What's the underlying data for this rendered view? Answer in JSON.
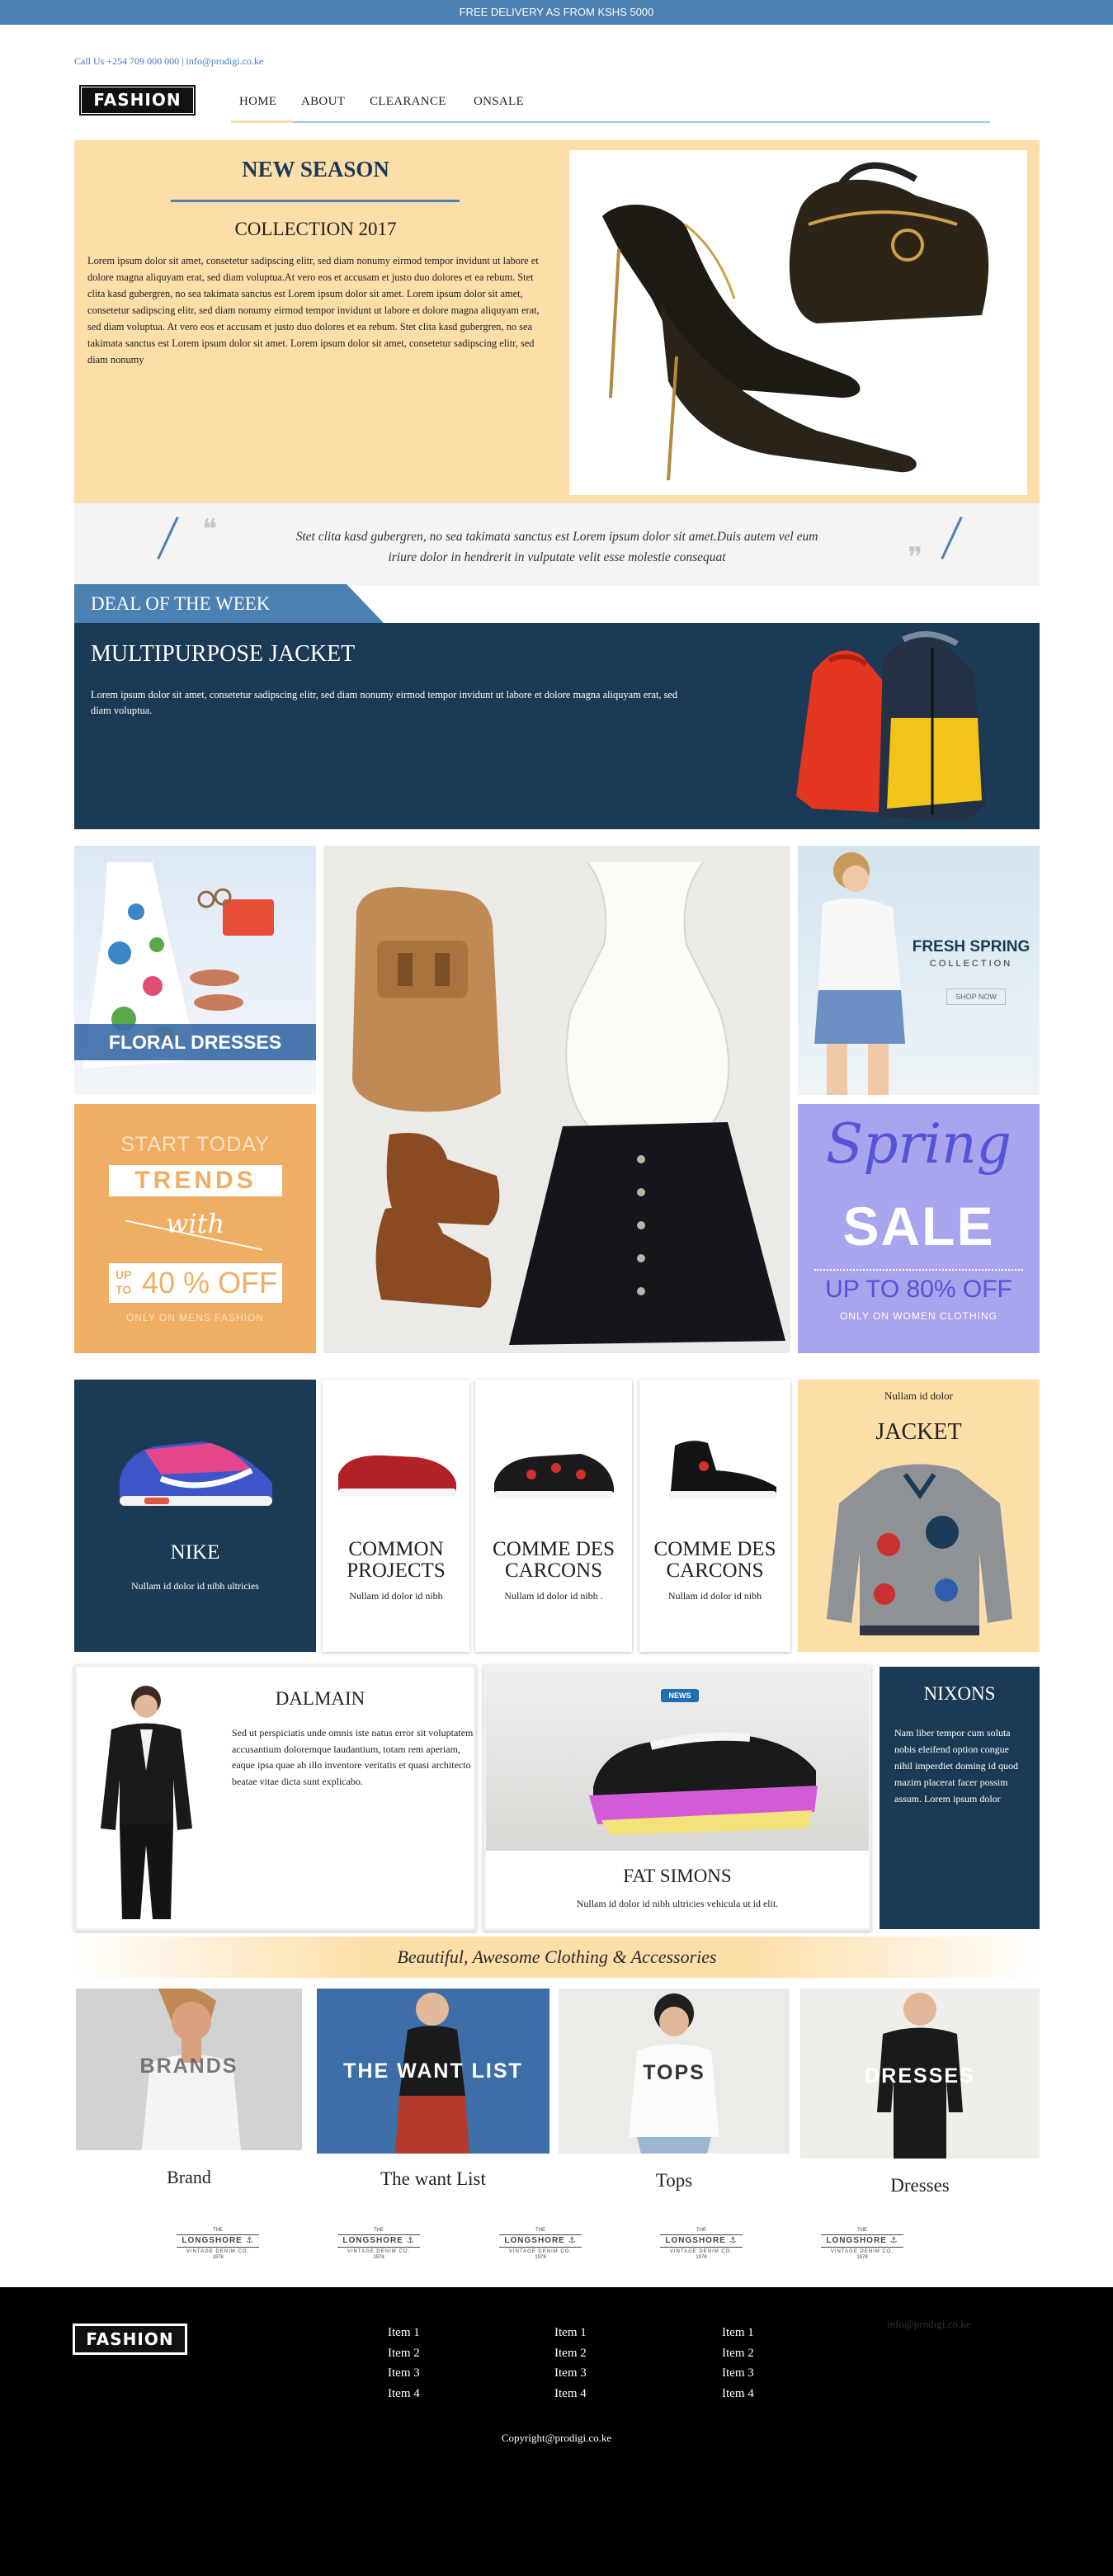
{
  "topbar": {
    "text": "FREE DELIVERY AS FROM KSHS 5000"
  },
  "header": {
    "contact": "Call Us +254 709 000 000 | info@prodigi.co.ke",
    "logo": "FASHION",
    "nav": [
      {
        "label": "HOME"
      },
      {
        "label": "ABOUT"
      },
      {
        "label": "CLEARANCE"
      },
      {
        "label": "ONSALE"
      }
    ]
  },
  "hero": {
    "title": "NEW SEASON",
    "subtitle": "COLLECTION 2017",
    "body": "Lorem ipsum dolor sit amet, consetetur sadipscing elitr,  sed diam nonumy eirmod tempor invidunt ut labore et dolore magna aliquyam erat, sed diam voluptua.At vero eos et accusam et justo duo dolores et ea rebum. Stet clita kasd gubergren, no sea takimata sanctus est Lorem ipsum dolor sit amet. Lorem ipsum dolor sit amet, consetetur sadipscing elitr,  sed diam nonumy eirmod tempor invidunt ut labore et dolore magna aliquyam erat, sed diam voluptua. At vero eos et accusam et justo duo dolores et ea rebum. Stet clita kasd gubergren, no sea takimata sanctus est Lorem ipsum dolor sit amet. Lorem ipsum dolor sit amet, consetetur sadipscing elitr,  sed diam nonumy"
  },
  "quote": {
    "line1": "Stet clita kasd gubergren, no sea takimata sanctus est Lorem ipsum dolor sit amet.Duis autem vel eum",
    "line2": "iriure dolor in hendrerit in vulputate velit esse molestie consequat"
  },
  "deal": {
    "tag": "DEAL OF THE WEEK",
    "title": "MULTIPURPOSE JACKET",
    "body": "Lorem ipsum dolor sit amet, consetetur sadipscing elitr,  sed diam nonumy eirmod tempor invidunt ut labore et dolore magna aliquyam erat, sed diam voluptua."
  },
  "promos": {
    "floral": "FLORAL DRESSES",
    "spring1": "FRESH SPRING",
    "spring2": "COLLECTION",
    "spring_btn": "SHOP NOW",
    "trends_start": "START TODAY",
    "trends": "TRENDS",
    "trends_with": "with",
    "trends_up": "UP",
    "trends_to": "TO",
    "trends_off": "40 % OFF",
    "trends_note": "ONLY ON MENS FASHION",
    "sale_spring": "Spring",
    "sale": "SALE",
    "sale_off": "UP TO 80% OFF",
    "sale_note": "ONLY ON WOMEN CLOTHING"
  },
  "products": [
    {
      "title": "NIKE",
      "subtitle": "Nullam id dolor id nibh ultricies"
    },
    {
      "title": "COMMON PROJECTS",
      "subtitle": "Nullam id dolor id nibh"
    },
    {
      "title": "COMME DES CARCONS",
      "subtitle": "Nullam id dolor id nibh ."
    },
    {
      "title": "COMME DES CARCONS",
      "subtitle": "Nullam id dolor id nibh"
    }
  ],
  "jacket": {
    "top": "Nullam id dolor",
    "title": "JACKET"
  },
  "dalmain": {
    "title": "DALMAIN",
    "body": "Sed ut perspiciatis unde omnis iste natus error sit voluptatem accusantium doloremque laudantium, totam rem aperiam, eaque ipsa quae ab illo inventore veritatis et quasi architecto beatae vitae dicta sunt explicabo."
  },
  "fatsimons": {
    "badge": "NEWS",
    "title": "FAT SIMONS",
    "subtitle": "Nullam id dolor id nibh ultricies vehicula ut id elit."
  },
  "nixons": {
    "title": "NIXONS",
    "body": "Nam liber tempor cum soluta nobis eleifend option congue nihil imperdiet doming id quod mazim placerat facer possim assum. Lorem ipsum dolor"
  },
  "banner": {
    "text": "Beautiful, Awesome Clothing & Accessories"
  },
  "categories": [
    {
      "overlay": "BRANDS",
      "caption": "Brand"
    },
    {
      "overlay": "THE WANT LIST",
      "caption": "The want List"
    },
    {
      "overlay": "TOPS",
      "caption": "Tops"
    },
    {
      "overlay": "DRESSES",
      "caption": "Dresses"
    }
  ],
  "brands": {
    "line1": "THE",
    "name": "LONGSHORE",
    "line3": "VINTAGE DENIM CO.",
    "year": "1978"
  },
  "footer": {
    "logo": "FASHION",
    "email": "info@prodigi.co.ke",
    "copyright": "Copyright@prodigi.co.ke",
    "columns": [
      [
        "Item 1",
        "Item 2",
        "Item 3",
        "Item 4"
      ],
      [
        "Item 1",
        "Item 2",
        "Item 3",
        "Item 4"
      ],
      [
        "Item 1",
        "Item 2",
        "Item 3",
        "Item 4"
      ]
    ]
  },
  "colors": {
    "brand_blue": "#4a80b2",
    "navy": "#1b3a55",
    "peach": "#fddea8",
    "lavender": "#a9a4ee",
    "orange": "#efae63"
  }
}
